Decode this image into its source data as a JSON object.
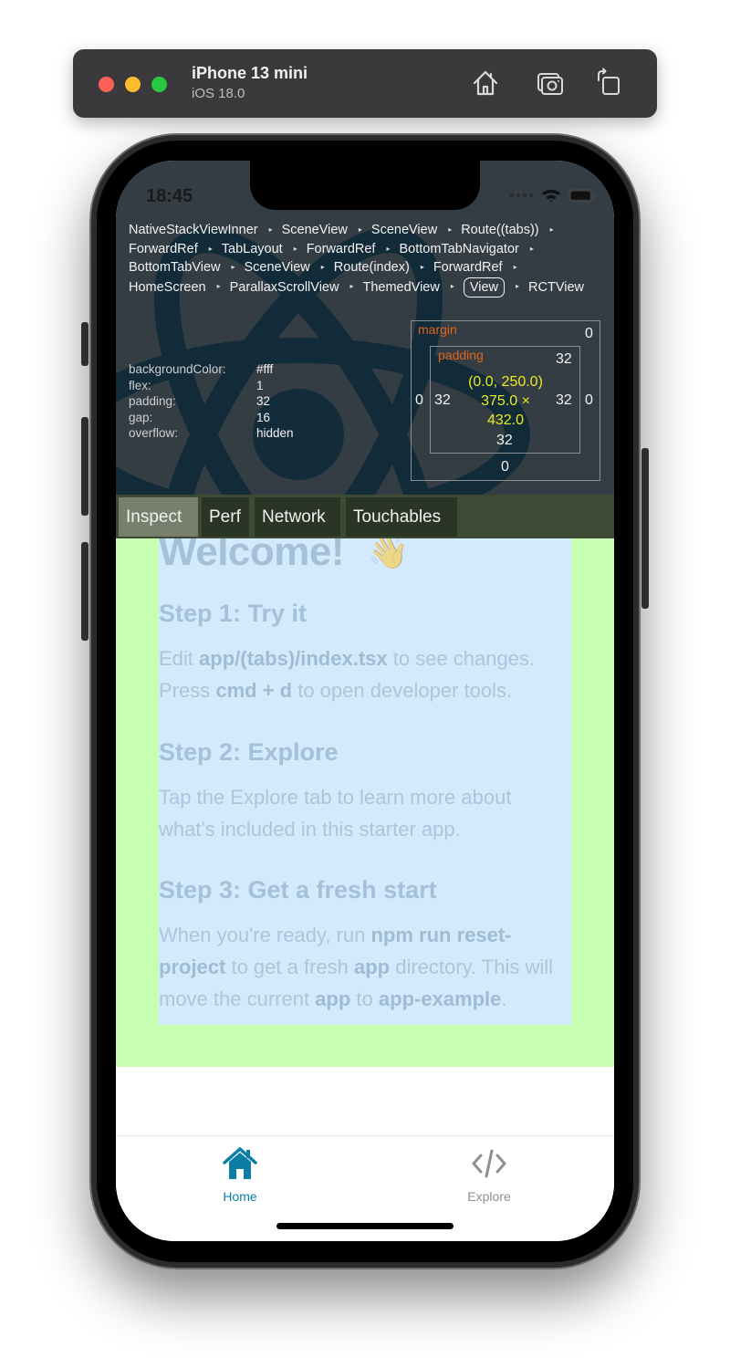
{
  "simulator": {
    "device_name": "iPhone 13 mini",
    "os_version": "iOS 18.0",
    "toolbar_icons": [
      "home-icon",
      "screenshot-icon",
      "rotate-icon"
    ]
  },
  "status_bar": {
    "time": "18:45",
    "icons": [
      "signal-icon",
      "wifi-icon",
      "battery-icon"
    ]
  },
  "inspector": {
    "breadcrumbs": [
      "NativeStackViewInner",
      "SceneView",
      "SceneView",
      "Route((tabs))",
      "ForwardRef",
      "TabLayout",
      "ForwardRef",
      "BottomTabNavigator",
      "BottomTabView",
      "SceneView",
      "Route(index)",
      "ForwardRef",
      "HomeScreen",
      "ParallaxScrollView",
      "ThemedView",
      "View",
      "RCTView"
    ],
    "selected_crumb": "View",
    "style_props": [
      {
        "key": "backgroundColor:",
        "value": "#fff"
      },
      {
        "key": "flex:",
        "value": "1"
      },
      {
        "key": "padding:",
        "value": "32"
      },
      {
        "key": "gap:",
        "value": "16"
      },
      {
        "key": "overflow:",
        "value": "hidden"
      }
    ],
    "box_model": {
      "margin_label": "margin",
      "padding_label": "padding",
      "margin": {
        "top": "0",
        "right": "0",
        "bottom": "0",
        "left": "0"
      },
      "padding": {
        "top": "32",
        "right": "32",
        "bottom": "32",
        "left": "32"
      },
      "position": "(0.0, 250.0)",
      "size_line1": "375.0 ×",
      "size_line2": "432.0"
    },
    "tabs": [
      {
        "label": "Inspect",
        "active": true
      },
      {
        "label": "Perf",
        "active": false
      },
      {
        "label": "Network",
        "active": false
      },
      {
        "label": "Touchables",
        "active": false
      }
    ]
  },
  "content": {
    "title": "Welcome!",
    "title_emoji": "👋",
    "steps": [
      {
        "title": "Step 1: Try it",
        "body": [
          {
            "text": "Edit ",
            "bold": false
          },
          {
            "text": "app/(tabs)/index.tsx",
            "bold": true
          },
          {
            "text": " to see changes. Press ",
            "bold": false
          },
          {
            "text": "cmd + d",
            "bold": true
          },
          {
            "text": " to open developer tools.",
            "bold": false
          }
        ]
      },
      {
        "title": "Step 2: Explore",
        "body": [
          {
            "text": "Tap the Explore tab to learn more about what's included in this starter app.",
            "bold": false
          }
        ]
      },
      {
        "title": "Step 3: Get a fresh start",
        "body": [
          {
            "text": "When you're ready, run ",
            "bold": false
          },
          {
            "text": "npm run reset-project",
            "bold": true
          },
          {
            "text": " to get a fresh ",
            "bold": false
          },
          {
            "text": "app",
            "bold": true
          },
          {
            "text": " directory. This will move the current ",
            "bold": false
          },
          {
            "text": "app",
            "bold": true
          },
          {
            "text": " to ",
            "bold": false
          },
          {
            "text": "app-example",
            "bold": true
          },
          {
            "text": ".",
            "bold": false
          }
        ]
      }
    ]
  },
  "tabbar": {
    "items": [
      {
        "label": "Home",
        "icon": "home-icon",
        "active": true
      },
      {
        "label": "Explore",
        "icon": "code-icon",
        "active": false
      }
    ],
    "active_color": "#0a7ea4",
    "inactive_color": "#8e8e93"
  },
  "colors": {
    "inspector_bg": "#343d44",
    "devtabs_bg": "#3d4b35",
    "padding_highlight": "#c8feb1",
    "content_highlight": "#d3e9fe",
    "box_label": "#e0651d",
    "box_dim": "#e9ea1f"
  }
}
